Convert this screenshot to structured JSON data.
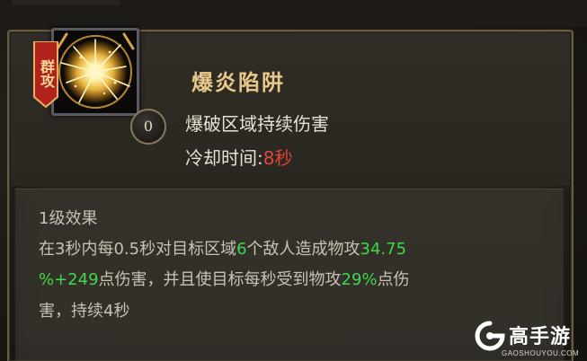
{
  "skill": {
    "tag": "群攻",
    "name": "爆炎陷阱",
    "level": "0",
    "description": "爆破区域持续伤害",
    "cooldown_label": "冷却时间:",
    "cooldown_value": "8秒",
    "icon": "explosion-icon"
  },
  "effect": {
    "title": "1级效果",
    "line1": {
      "a": "在3秒内每0.5秒对目标区域",
      "b": "6",
      "c": "个敌人造成物攻",
      "d": "34.75"
    },
    "line2": {
      "a": "%+249",
      "b": "点伤害，并且使目标每秒受到物攻",
      "c": "29%",
      "d": "点伤"
    },
    "line3": "害，持续4秒"
  },
  "watermark": {
    "brand": "高手游",
    "url": "GAOSHOUYOU.COM"
  },
  "colors": {
    "accent_gold": "#e8c98a",
    "highlight_green": "#3fd84a",
    "cooldown_red": "#e0453a",
    "banner_red": "#b3231e"
  }
}
